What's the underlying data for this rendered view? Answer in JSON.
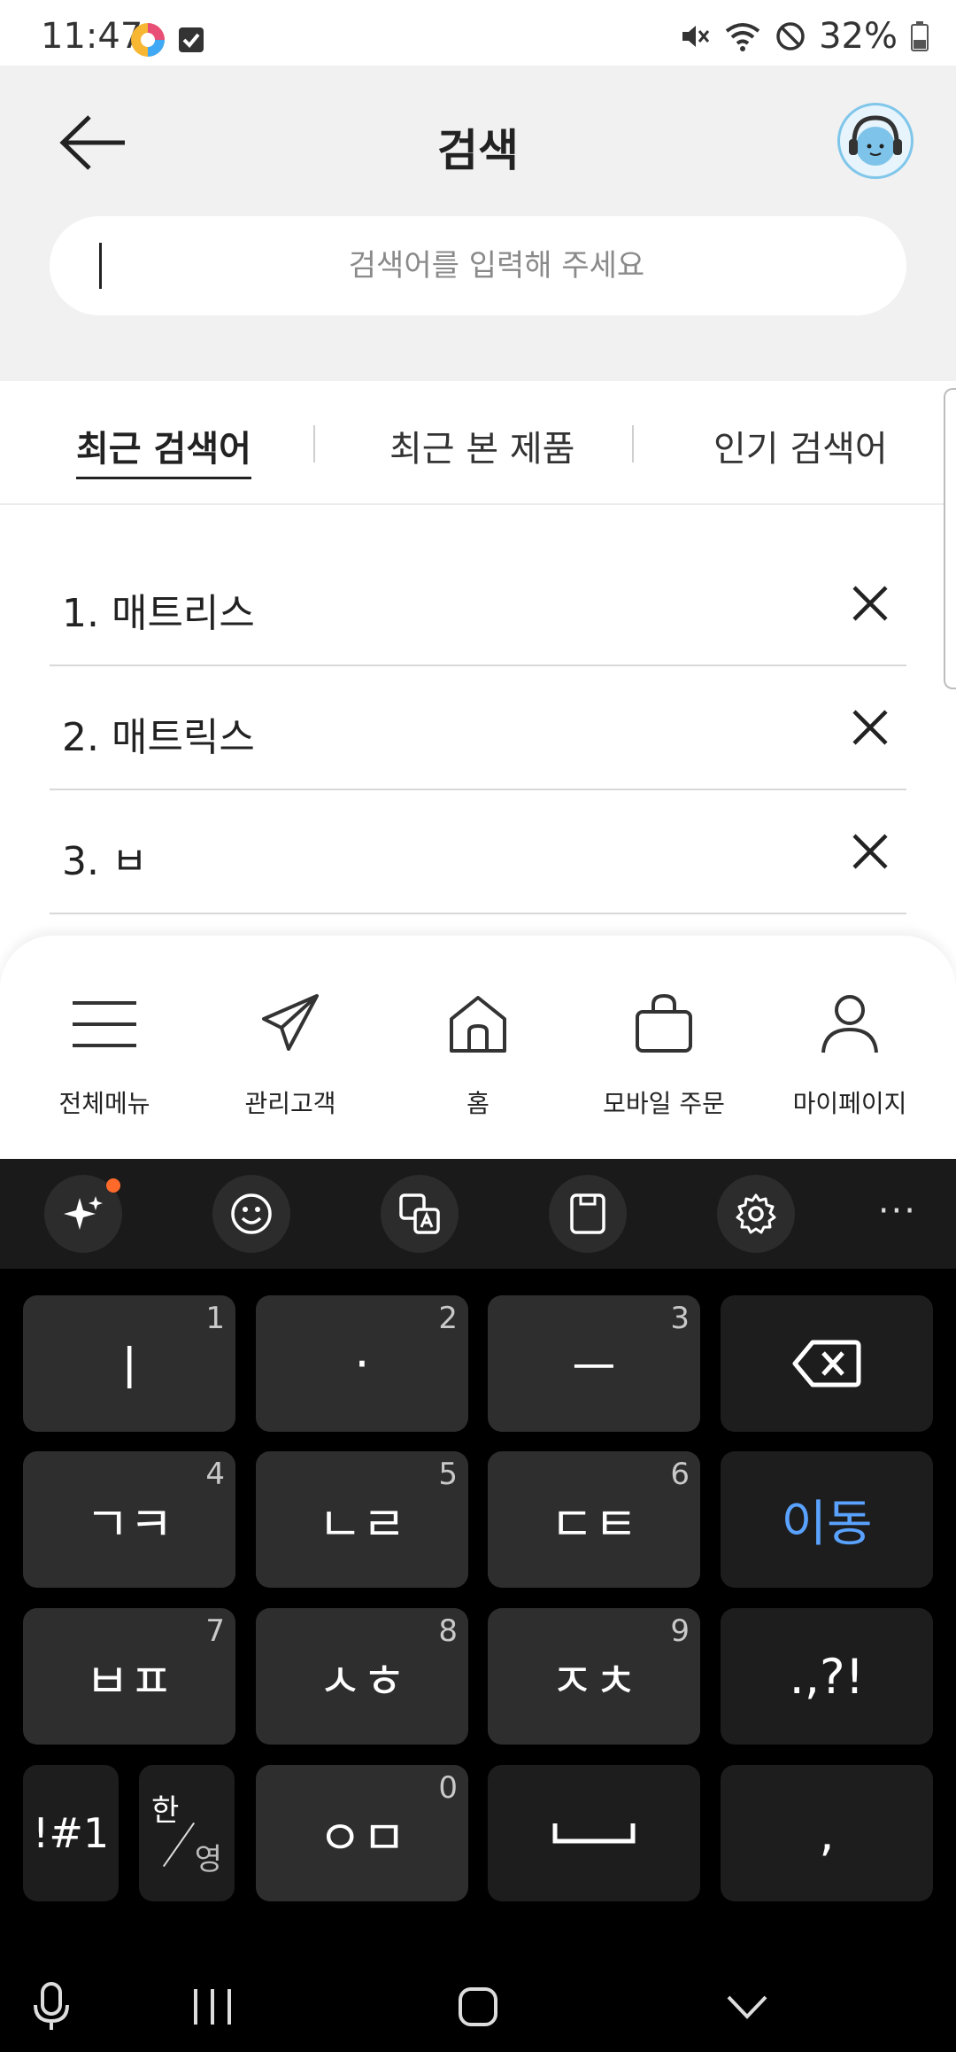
{
  "status_bar": {
    "time": "11:47",
    "battery": "32%",
    "icons": [
      "color-app-icon",
      "checkbox-notification-icon",
      "mute-icon",
      "wifi-icon",
      "dnd-icon",
      "battery-icon"
    ]
  },
  "header": {
    "title": "검색",
    "back_icon": "arrow-left-icon",
    "avatar_icon": "headset-avatar-icon"
  },
  "search": {
    "placeholder": "검색어를 입력해 주세요",
    "value": ""
  },
  "tabs": [
    {
      "label": "최근 검색어",
      "active": true
    },
    {
      "label": "최근 본 제품",
      "active": false
    },
    {
      "label": "인기 검색어",
      "active": false
    }
  ],
  "recent_searches": [
    {
      "label": "1. 매트리스"
    },
    {
      "label": "2. 매트릭스"
    },
    {
      "label": "3. ㅂ"
    }
  ],
  "bottom_nav": [
    {
      "label": "전체메뉴",
      "icon": "menu-icon"
    },
    {
      "label": "관리고객",
      "icon": "paper-plane-icon"
    },
    {
      "label": "홈",
      "icon": "home-icon"
    },
    {
      "label": "모바일 주문",
      "icon": "shopping-bag-icon"
    },
    {
      "label": "마이페이지",
      "icon": "person-icon"
    }
  ],
  "keyboard": {
    "toolbar": [
      "sparkle-ai-icon",
      "emoji-icon",
      "translate-icon",
      "clipboard-icon",
      "settings-icon",
      "more-icon"
    ],
    "more": "···",
    "rows": [
      [
        {
          "main": "ㅣ",
          "num": "1"
        },
        {
          "main": "·",
          "num": "2"
        },
        {
          "main": "ㅡ",
          "num": "3"
        },
        {
          "main": "",
          "icon": "backspace-icon"
        }
      ],
      [
        {
          "main": "ㄱㅋ",
          "num": "4"
        },
        {
          "main": "ㄴㄹ",
          "num": "5"
        },
        {
          "main": "ㄷㅌ",
          "num": "6"
        },
        {
          "main": "이동"
        }
      ],
      [
        {
          "main": "ㅂㅍ",
          "num": "7"
        },
        {
          "main": "ㅅㅎ",
          "num": "8"
        },
        {
          "main": "ㅈㅊ",
          "num": "9"
        },
        {
          "main": ".,?!"
        }
      ],
      [
        {
          "main": "!#1"
        },
        {
          "top": "한",
          "bottom": "영"
        },
        {
          "main": "ㅇㅁ",
          "num": "0"
        },
        {
          "main": "",
          "icon": "space-icon"
        },
        {
          "main": ","
        }
      ]
    ],
    "accent": "#5aa2ff"
  },
  "system_nav": [
    "mic-icon",
    "recents-icon",
    "home-button-icon",
    "hide-keyboard-icon"
  ]
}
